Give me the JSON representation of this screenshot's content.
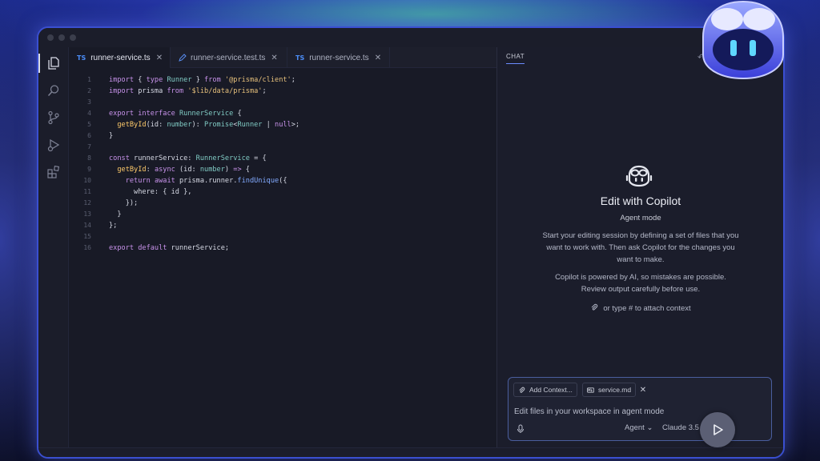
{
  "tabs": [
    {
      "lang": "TS",
      "label": "runner-service.ts",
      "close": "✕",
      "active": true
    },
    {
      "lang": "",
      "label": "runner-service.test.ts",
      "close": "✕",
      "active": false
    },
    {
      "lang": "TS",
      "label": "runner-service.ts",
      "close": "✕",
      "active": false
    }
  ],
  "editor": {
    "line_numbers": [
      "1",
      "2",
      "3",
      "4",
      "5",
      "6",
      "7",
      "8",
      "9",
      "10",
      "11",
      "12",
      "13",
      "14",
      "15",
      "16"
    ]
  },
  "chat": {
    "header_label": "CHAT",
    "undo_icon": "↶",
    "title": "Edit with Copilot",
    "mode": "Agent mode",
    "description": "Start your editing session by defining a set of files that you want to work with. Then ask Copilot for the changes you want to make.",
    "disclaimer": "Copilot is powered by AI, so mistakes are possible. Review output carefully before use.",
    "attach_hint": "or type # to attach context",
    "chips": {
      "add_context": "Add Context...",
      "file": "service.md",
      "close": "✕"
    },
    "input_placeholder": "Edit files in your workspace in agent mode",
    "agent_select": "Agent ⌄",
    "model_select": "Claude 3.5 Sonnet ⌄"
  },
  "colors": {
    "accent": "#6b8cff",
    "window_border": "#3a4fd0",
    "ts_badge": "#4b8df7"
  },
  "icons": {
    "activity": [
      "files-icon",
      "search-icon",
      "source-control-icon",
      "run-debug-icon",
      "extensions-icon"
    ],
    "chat": [
      "copilot-icon",
      "paperclip-icon",
      "microphone-icon",
      "send-icon"
    ]
  }
}
